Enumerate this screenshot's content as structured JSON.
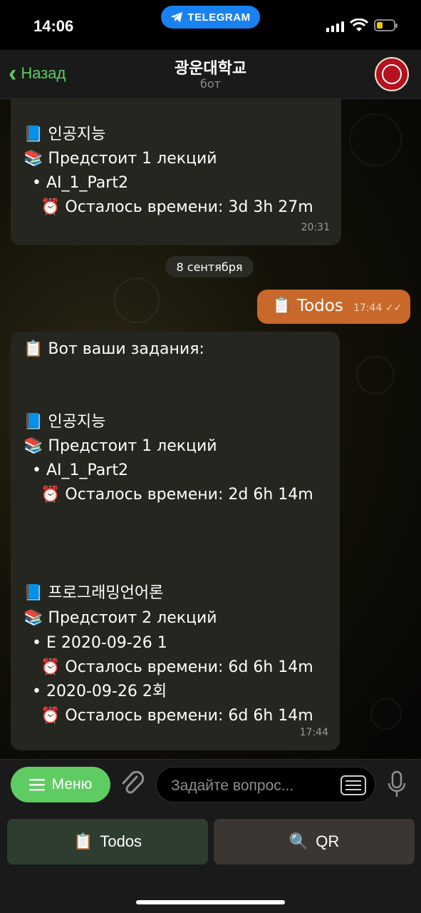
{
  "status_bar": {
    "time": "14:06",
    "app_pill": "TELEGRAM"
  },
  "header": {
    "back_label": "Назад",
    "title": "광운대학교",
    "subtitle": "бот"
  },
  "messages": {
    "first": {
      "lines": [
        {
          "emoji": "📘",
          "text": "인공지능"
        },
        {
          "emoji": "📚",
          "text": "Предстоит 1 лекций"
        },
        {
          "emoji": "•",
          "text": "AI_1_Part2"
        },
        {
          "emoji": "⏰",
          "text": "Осталось времени: 3d 3h 27m"
        }
      ],
      "time": "20:31"
    },
    "date_separator": "8 сентября",
    "outgoing": {
      "emoji": "📋",
      "text": "Todos",
      "time": "17:44",
      "status": "✓✓"
    },
    "second": {
      "lines": [
        {
          "emoji": "📋",
          "text": "Вот ваши задания:"
        },
        {
          "emoji": "📘",
          "text": "인공지능"
        },
        {
          "emoji": "📚",
          "text": "Предстоит 1 лекций"
        },
        {
          "emoji": "•",
          "text": "AI_1_Part2"
        },
        {
          "emoji": "⏰",
          "text": "Осталось времени: 2d 6h 14m"
        },
        {
          "emoji": "📘",
          "text": "프로그래밍언어론"
        },
        {
          "emoji": "📚",
          "text": "Предстоит 2 лекций"
        },
        {
          "emoji": "•",
          "text": "E 2020-09-26 1"
        },
        {
          "emoji": "⏰",
          "text": "Осталось времени: 6d 6h 14m"
        },
        {
          "emoji": "•",
          "text": "2020-09-26 2회"
        },
        {
          "emoji": "⏰",
          "text": "Осталось времени: 6d 6h 14m"
        }
      ],
      "time": "17:44"
    }
  },
  "input_bar": {
    "menu_label": "Меню",
    "placeholder": "Задайте вопрос..."
  },
  "keyboard": {
    "buttons": [
      {
        "emoji": "📋",
        "label": "Todos"
      },
      {
        "emoji": "🔍",
        "label": "QR"
      }
    ]
  },
  "colors": {
    "accent": "#5ecc62",
    "outgoing_bubble": "#c8692b",
    "incoming_bubble": "#24261f",
    "telegram_blue": "#1a82f0"
  }
}
